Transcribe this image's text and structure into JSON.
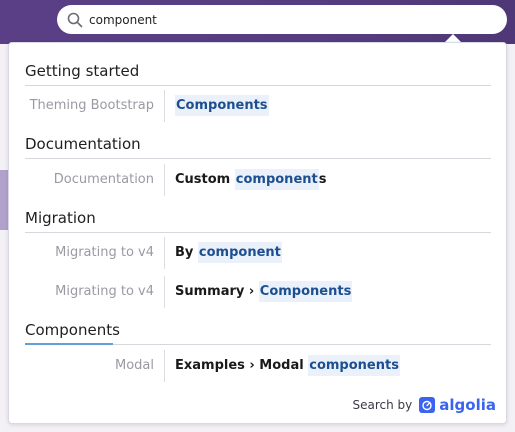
{
  "search": {
    "value": "component",
    "placeholder": ""
  },
  "categories": [
    {
      "label": "Getting started",
      "items": [
        {
          "subcategory": "Theming Bootstrap",
          "pre": "",
          "match": "Components",
          "post": ""
        }
      ]
    },
    {
      "label": "Documentation",
      "items": [
        {
          "subcategory": "Documentation",
          "pre": "Custom ",
          "match": "component",
          "post": "s"
        }
      ]
    },
    {
      "label": "Migration",
      "items": [
        {
          "subcategory": "Migrating to v4",
          "pre": "By ",
          "match": "component",
          "post": ""
        },
        {
          "subcategory": "Migrating to v4",
          "pre": "Summary › ",
          "match": "Components",
          "post": ""
        }
      ]
    },
    {
      "label": "Components",
      "items": [
        {
          "subcategory": "Modal",
          "pre": "Examples › Modal ",
          "match": "components",
          "post": ""
        }
      ]
    }
  ],
  "footer": {
    "search_by": "Search by",
    "brand": "algolia"
  },
  "icons": {
    "search": "search-icon",
    "algolia": "algolia-logo-icon"
  },
  "colors": {
    "header_bg": "#563d80",
    "highlight_text": "#1d4f8f",
    "highlight_bg": "#eaf1fb",
    "brand": "#3b63f0",
    "active_underline": "#5fa0d6"
  }
}
